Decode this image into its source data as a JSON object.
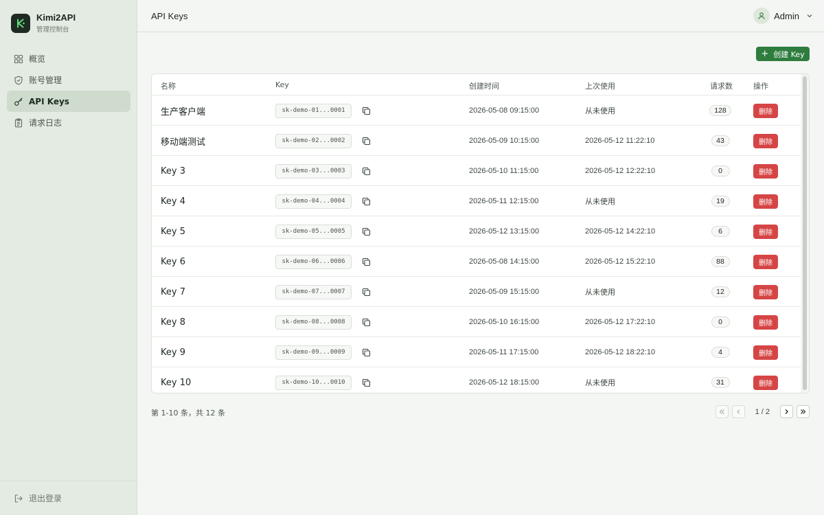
{
  "brand": {
    "name": "Kimi2API",
    "subtitle": "管理控制台",
    "logo_letter": "K"
  },
  "nav": [
    {
      "label": "概览",
      "icon": "dashboard-icon",
      "active": false
    },
    {
      "label": "账号管理",
      "icon": "shield-icon",
      "active": false
    },
    {
      "label": "API Keys",
      "icon": "key-icon",
      "active": true
    },
    {
      "label": "请求日志",
      "icon": "clipboard-icon",
      "active": false
    }
  ],
  "logout": {
    "label": "退出登录",
    "icon": "logout-icon"
  },
  "header": {
    "title": "API Keys",
    "user": "Admin"
  },
  "toolbar": {
    "create_label": "创建 Key"
  },
  "table": {
    "columns": [
      "名称",
      "Key",
      "创建时间",
      "上次使用",
      "请求数",
      "操作"
    ],
    "delete_label": "删除",
    "rows": [
      {
        "name": "生产客户端",
        "key": "sk-demo-01...0001",
        "created": "2026-05-08 09:15:00",
        "last_used": "从未使用",
        "count": "128"
      },
      {
        "name": "移动端测试",
        "key": "sk-demo-02...0002",
        "created": "2026-05-09 10:15:00",
        "last_used": "2026-05-12 11:22:10",
        "count": "43"
      },
      {
        "name": "Key 3",
        "key": "sk-demo-03...0003",
        "created": "2026-05-10 11:15:00",
        "last_used": "2026-05-12 12:22:10",
        "count": "0"
      },
      {
        "name": "Key 4",
        "key": "sk-demo-04...0004",
        "created": "2026-05-11 12:15:00",
        "last_used": "从未使用",
        "count": "19"
      },
      {
        "name": "Key 5",
        "key": "sk-demo-05...0005",
        "created": "2026-05-12 13:15:00",
        "last_used": "2026-05-12 14:22:10",
        "count": "6"
      },
      {
        "name": "Key 6",
        "key": "sk-demo-06...0006",
        "created": "2026-05-08 14:15:00",
        "last_used": "2026-05-12 15:22:10",
        "count": "88"
      },
      {
        "name": "Key 7",
        "key": "sk-demo-07...0007",
        "created": "2026-05-09 15:15:00",
        "last_used": "从未使用",
        "count": "12"
      },
      {
        "name": "Key 8",
        "key": "sk-demo-08...0008",
        "created": "2026-05-10 16:15:00",
        "last_used": "2026-05-12 17:22:10",
        "count": "0"
      },
      {
        "name": "Key 9",
        "key": "sk-demo-09...0009",
        "created": "2026-05-11 17:15:00",
        "last_used": "2026-05-12 18:22:10",
        "count": "4"
      },
      {
        "name": "Key 10",
        "key": "sk-demo-10...0010",
        "created": "2026-05-12 18:15:00",
        "last_used": "从未使用",
        "count": "31"
      }
    ]
  },
  "footer": {
    "summary": "第 1-10 条，共 12 条",
    "page": "1 / 2"
  },
  "colors": {
    "accent": "#2f7d3e",
    "danger": "#d64545",
    "sidebar_bg": "#e4ebe3",
    "active_nav": "#cfdccd"
  }
}
